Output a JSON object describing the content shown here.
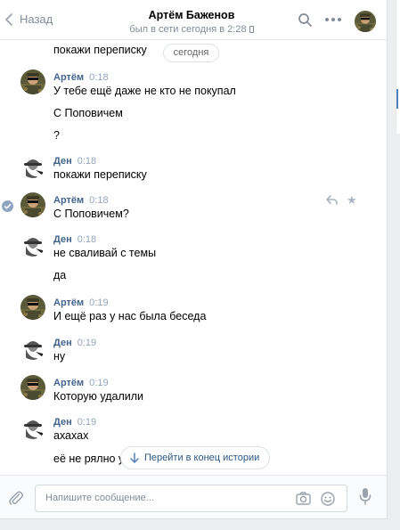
{
  "header": {
    "back_label": "Назад",
    "title": "Артём Баженов",
    "subtitle": "был в сети сегодня в 2:28"
  },
  "history": {
    "date_pill": "сегодня",
    "partial_top": {
      "text": "покажи переписку"
    },
    "messages": [
      {
        "author": "Артём",
        "time": "0:18",
        "lines": [
          "У тебе ещё даже не кто не покупал",
          "С Поповичем",
          "?"
        ]
      },
      {
        "author": "Ден",
        "time": "0:18",
        "lines": [
          "покажи переписку"
        ]
      },
      {
        "author": "Артём",
        "time": "0:18",
        "lines": [
          "С Поповичем?"
        ]
      },
      {
        "author": "Ден",
        "time": "0:18",
        "lines": [
          "не сваливай с темы",
          "да"
        ]
      },
      {
        "author": "Артём",
        "time": "0:19",
        "lines": [
          "И ещё раз у нас была беседа"
        ]
      },
      {
        "author": "Ден",
        "time": "0:19",
        "lines": [
          "ну"
        ]
      },
      {
        "author": "Артём",
        "time": "0:19",
        "lines": [
          "Которую удалили"
        ]
      },
      {
        "author": "Ден",
        "time": "0:19",
        "lines": [
          "ахахах",
          "её не рялно уд"
        ]
      }
    ],
    "goto_end_label": "Перейти в конец истории"
  },
  "composer": {
    "placeholder": "Напишите сообщение..."
  },
  "colors": {
    "accent": "#5181b8",
    "author": "#42648b",
    "muted": "#828a99"
  }
}
